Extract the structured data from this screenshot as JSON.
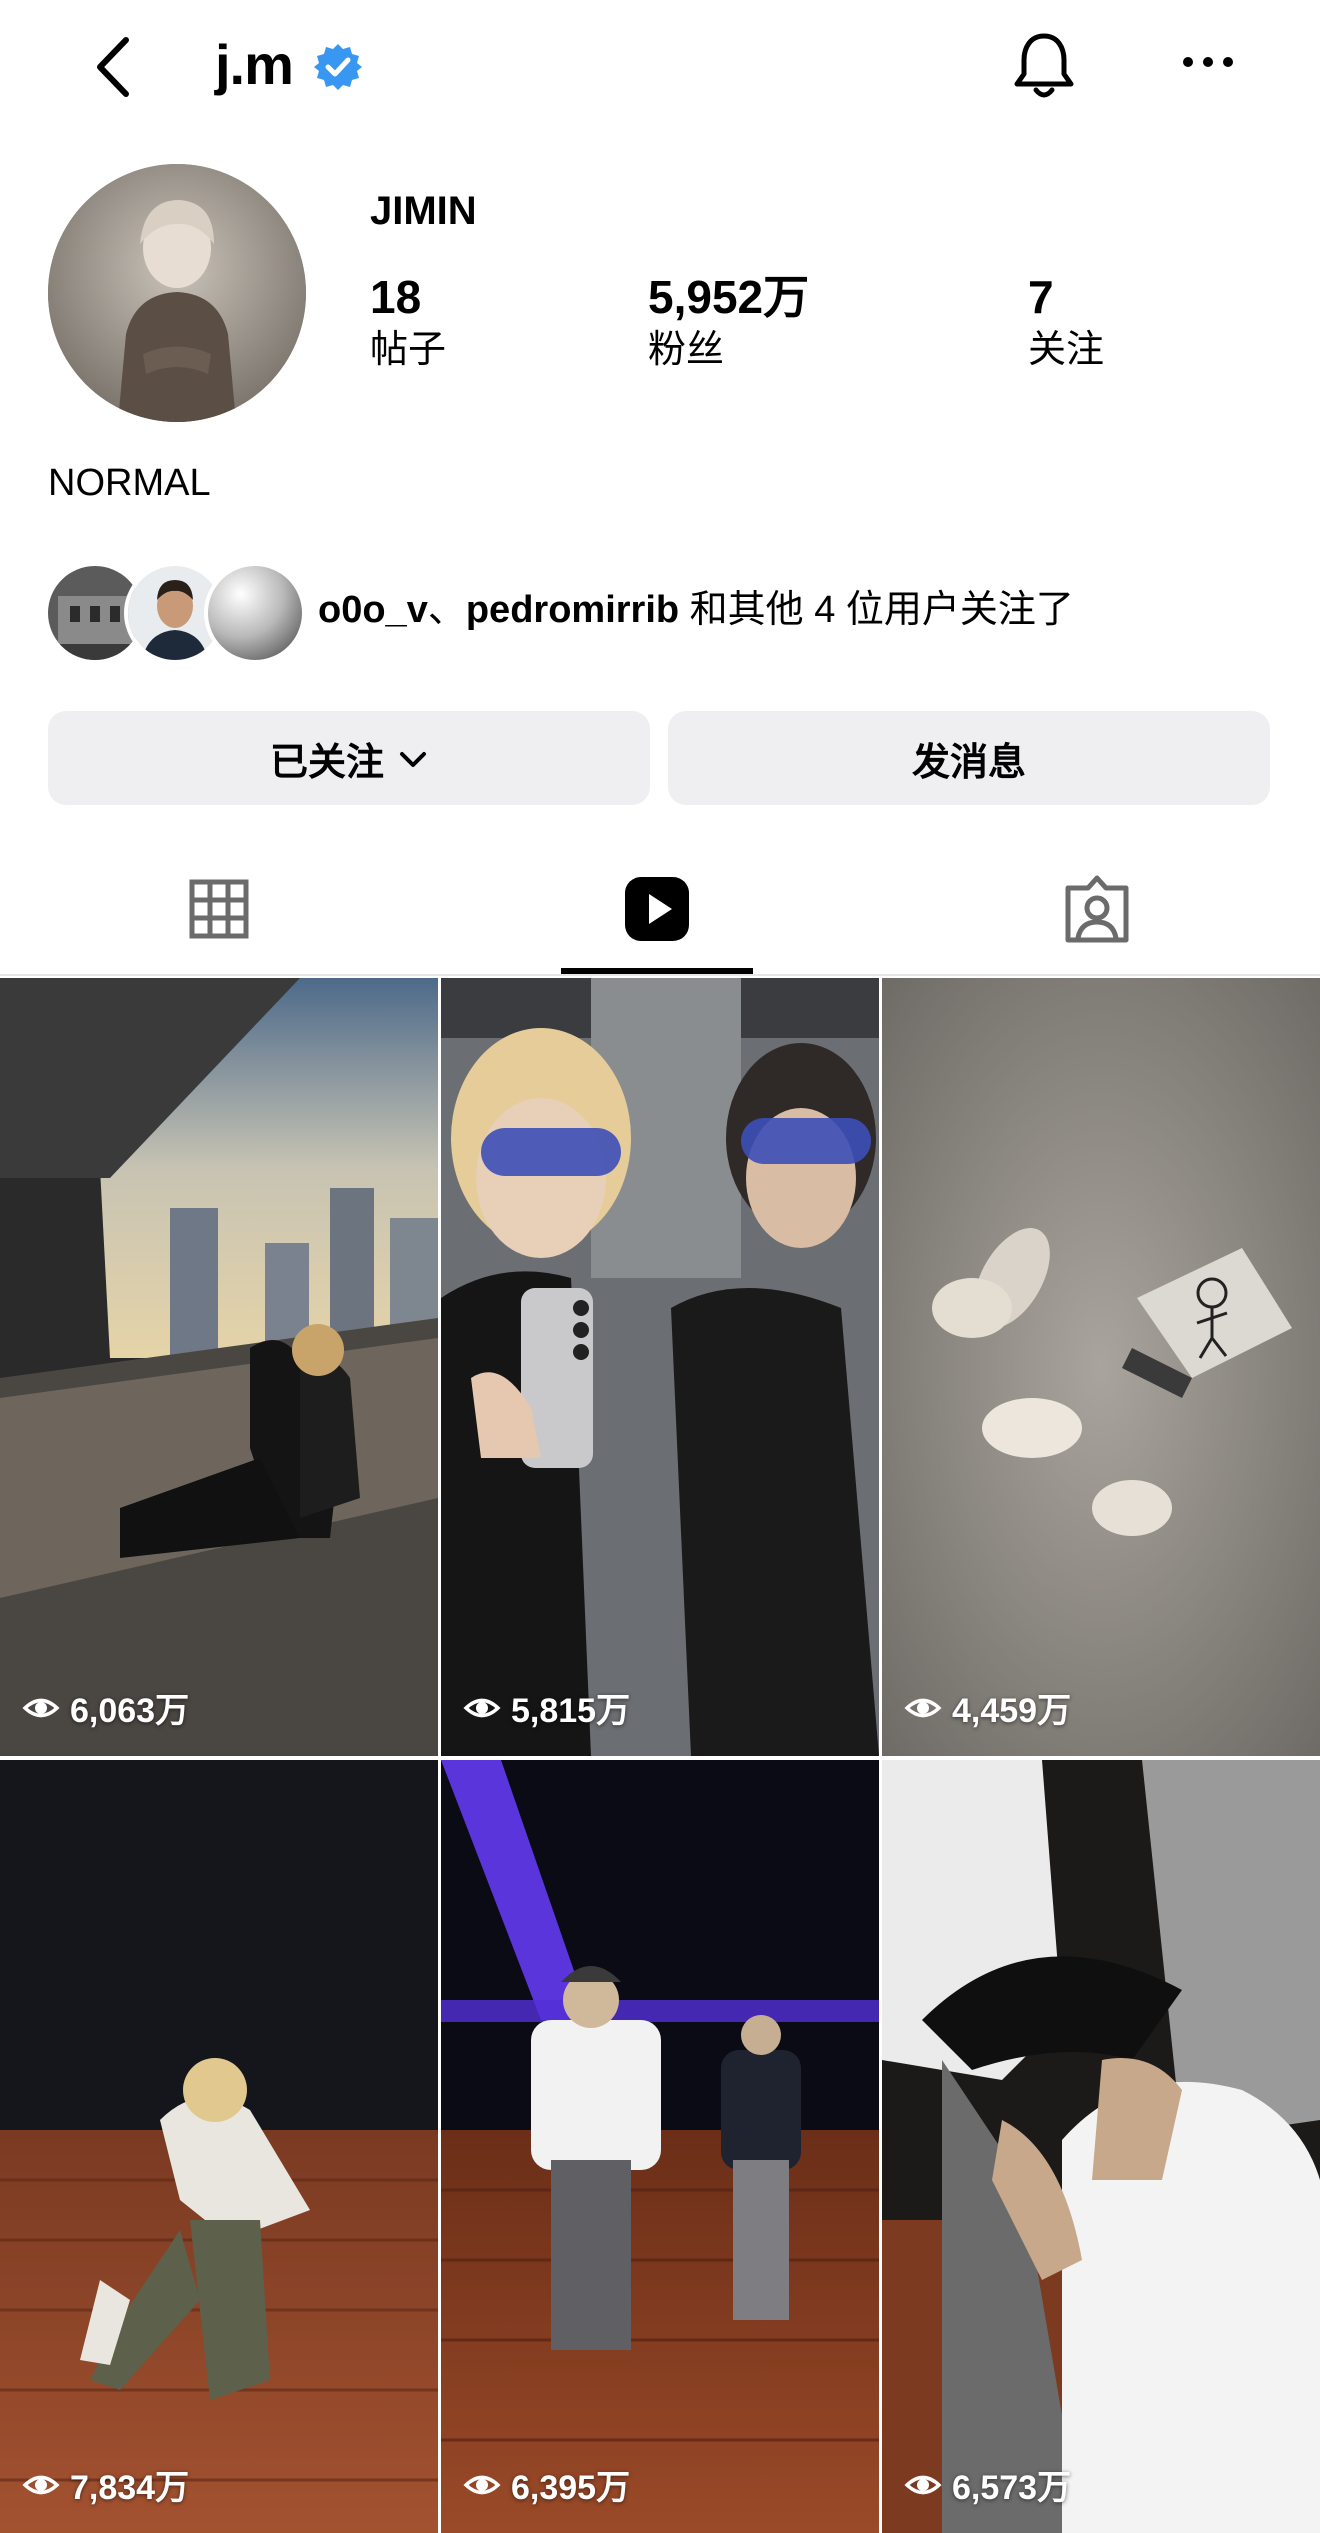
{
  "header": {
    "handle": "j.m"
  },
  "profile": {
    "name": "JIMIN",
    "stats": [
      {
        "value": "18",
        "label": "帖子"
      },
      {
        "value": "5,952万",
        "label": "粉丝"
      },
      {
        "value": "7",
        "label": "关注"
      }
    ],
    "bio": "NORMAL"
  },
  "followed_by": {
    "user1": "o0o_v",
    "sep": "、",
    "user2": "pedromirrib",
    "suffix": " 和其他 4 位用户关注了"
  },
  "actions": {
    "following_label": "已关注",
    "message_label": "发消息"
  },
  "tabs": [
    "grid-icon",
    "reels-icon",
    "tagged-icon"
  ],
  "active_tab": "reels-icon",
  "reels": [
    {
      "views": "6,063万"
    },
    {
      "views": "5,815万"
    },
    {
      "views": "4,459万"
    },
    {
      "views": "7,834万"
    },
    {
      "views": "6,395万"
    },
    {
      "views": "6,573万"
    }
  ],
  "colors": {
    "verified": "#3897f0",
    "button_bg": "#efeff2",
    "accent_purple": "#6a3dff"
  }
}
